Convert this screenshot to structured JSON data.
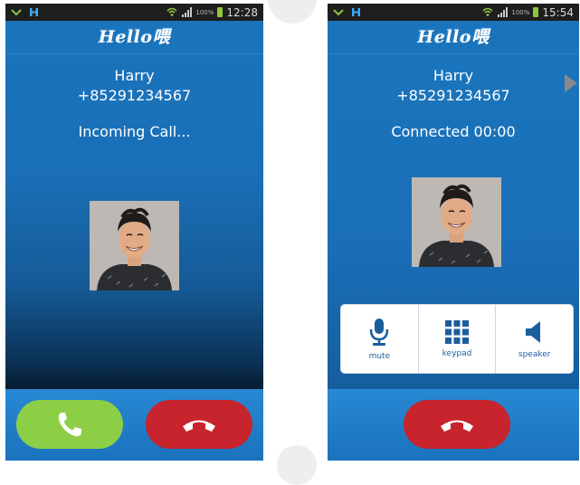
{
  "left_screen": {
    "status": {
      "time": "12:28",
      "battery": "100%"
    },
    "app_title": "Hello喂",
    "caller": {
      "name": "Harry",
      "number": "+85291234567"
    },
    "call_status": "Incoming Call...",
    "buttons": {
      "answer_icon": "phone-answer-icon",
      "decline_icon": "phone-hangup-icon"
    }
  },
  "right_screen": {
    "status": {
      "time": "15:54",
      "battery": "100%"
    },
    "app_title": "Hello喂",
    "caller": {
      "name": "Harry",
      "number": "+85291234567"
    },
    "call_status": "Connected 00:00",
    "controls": [
      {
        "label": "mute",
        "icon": "microphone-icon"
      },
      {
        "label": "keypad",
        "icon": "keypad-icon"
      },
      {
        "label": "speaker",
        "icon": "speaker-icon"
      }
    ],
    "buttons": {
      "end_icon": "phone-hangup-icon"
    }
  },
  "colors": {
    "screen_blue": "#1a75bd",
    "answer_green": "#8ccf46",
    "hangup_red": "#c8242d",
    "control_blue": "#1b5e9e"
  }
}
